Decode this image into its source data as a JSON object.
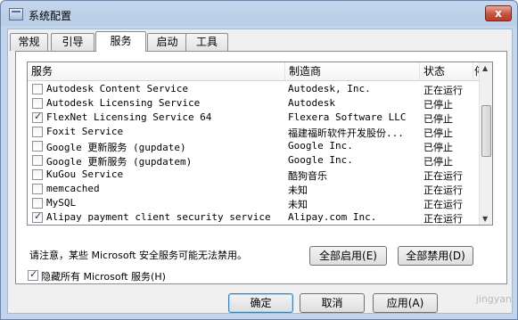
{
  "window": {
    "title": "系统配置",
    "close_label": "x"
  },
  "tabs": [
    {
      "label": "常规"
    },
    {
      "label": "引导"
    },
    {
      "label": "服务",
      "active": true
    },
    {
      "label": "启动"
    },
    {
      "label": "工具"
    }
  ],
  "services": {
    "columns": [
      "服务",
      "制造商",
      "状态",
      "停"
    ],
    "rows": [
      {
        "checked": false,
        "name": "Autodesk Content Service",
        "maker": "Autodesk, Inc.",
        "status": "正在运行"
      },
      {
        "checked": false,
        "name": "Autodesk Licensing Service",
        "maker": "Autodesk",
        "status": "已停止"
      },
      {
        "checked": true,
        "name": "FlexNet Licensing Service 64",
        "maker": "Flexera Software LLC",
        "status": "已停止"
      },
      {
        "checked": false,
        "name": "Foxit Service",
        "maker": "福建福昕软件开发股份...",
        "status": "已停止"
      },
      {
        "checked": false,
        "name": "Google 更新服务 (gupdate)",
        "maker": "Google Inc.",
        "status": "已停止"
      },
      {
        "checked": false,
        "name": "Google 更新服务 (gupdatem)",
        "maker": "Google Inc.",
        "status": "已停止"
      },
      {
        "checked": false,
        "name": "KuGou Service",
        "maker": "酷狗音乐",
        "status": "正在运行"
      },
      {
        "checked": false,
        "name": "memcached",
        "maker": "未知",
        "status": "正在运行"
      },
      {
        "checked": false,
        "name": "MySQL",
        "maker": "未知",
        "status": "正在运行"
      },
      {
        "checked": true,
        "name": "Alipay payment client security service",
        "maker": "Alipay.com Inc.",
        "status": "正在运行"
      }
    ]
  },
  "notice": "请注意，某些 Microsoft 安全服务可能无法禁用。",
  "buttons": {
    "enable_all": "全部启用(E)",
    "disable_all": "全部禁用(D)",
    "ok": "确定",
    "cancel": "取消",
    "apply": "应用(A)"
  },
  "hide_microsoft": {
    "label": "隐藏所有 Microsoft 服务(H)",
    "checked": true
  },
  "watermark": "jingyan"
}
